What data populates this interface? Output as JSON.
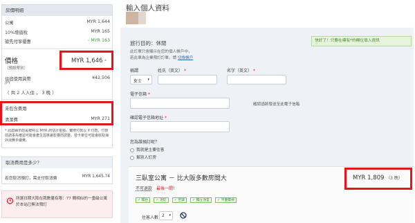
{
  "left": {
    "price_details_header": "房價明細",
    "rows": [
      {
        "label": "公寓",
        "value": "MYR 1,644"
      },
      {
        "label": "10%增值稅",
        "value": "MYR 165"
      },
      {
        "label": "搶先付享優惠",
        "value": "- MYR 163"
      }
    ],
    "price_label": "價格",
    "price_sub": "（預設幣別）",
    "price_value": "MYR 1,646",
    "price_asterisk": "*",
    "local_label": "住宿使用貨幣",
    "local_sub": "JPY",
    "local_value": "¥42,506",
    "guests_line": "（ 共 2 人入住 ， 3 晚 ）",
    "excluded_label": "未包含費用",
    "cleaning_label": "清潔費",
    "cleaning_value": "MYR 271",
    "footnote": "* 此處顯示的是按照以 MYR 的估計金額，實際付款以 ¥ 付款，付款前請事先確認可能會產生因率差影響而調整，發卡單位可能會收取海外消費手續費。",
    "cancel_header": "取消費用是多少？",
    "cancel_text": "若您取消預訂，需支付取消費",
    "cancel_value": "MYR 1,645.74",
    "alert_text": "所選日期大阪在我數量有限：77 間相似的一重級公寓於本站已無法預訂"
  },
  "main": {
    "title": "輸入個人資料",
    "notice": "快好了！只要在標有*的欄位填入資訊",
    "trip_purpose": "旅行目的：休閒",
    "trip_sub1": "此訂單只會顯示在您的個人帳戶中，",
    "trip_sub2": "若此單為企業預訂訂單，請",
    "trip_link": "切換帳戶",
    "title_label": "稱謂",
    "title_value": "女士",
    "lastname_label": "姓氏（英文）",
    "firstname_label": "名字（英文）",
    "email_label": "電子信箱",
    "email_hint": "確認函將發送至此電子信箱",
    "confirm_email_label": "確認電子信箱地址",
    "booking_for_label": "您為誰預訂呢？",
    "option1": "我就是主要住客",
    "option2": "幫別人訂房",
    "room_title": "三臥室公寓 － 比大阪多數房間大",
    "non_refundable": "不可退款",
    "lowest_price": "最後一間！",
    "room_price": "MYR 1,809",
    "room_nights": "（3 晚）",
    "amenities": [
      "陽台",
      "浴缸",
      "空調",
      "獨立浴室",
      "平面電視"
    ],
    "guests_label": "住客人數：",
    "guests_value": "2"
  },
  "colors": {
    "highlight": "#e8141d",
    "panel": "#eef1f6",
    "green": "#3a9b2c",
    "link": "#2a6fc4"
  }
}
